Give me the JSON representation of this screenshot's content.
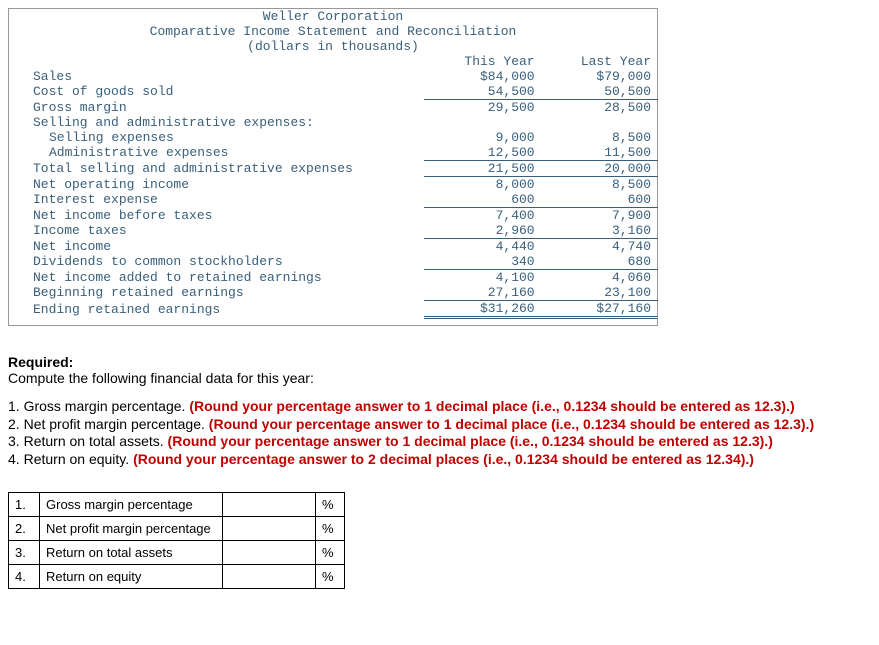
{
  "header": {
    "company": "Weller Corporation",
    "title": "Comparative Income Statement and Reconciliation",
    "sub": "(dollars in thousands)"
  },
  "cols": {
    "c1": "This Year",
    "c2": "Last Year"
  },
  "rows": {
    "sales": {
      "l": "Sales",
      "a": "$84,000",
      "b": "$79,000"
    },
    "cogs": {
      "l": "Cost of goods sold",
      "a": "54,500",
      "b": "50,500"
    },
    "gross": {
      "l": "Gross margin",
      "a": "29,500",
      "b": "28,500"
    },
    "sga_hdr": {
      "l": "Selling and administrative expenses:"
    },
    "sellexp": {
      "l": "Selling expenses",
      "a": "9,000",
      "b": "8,500"
    },
    "admexp": {
      "l": "Administrative expenses",
      "a": "12,500",
      "b": "11,500"
    },
    "totsga": {
      "l": "Total selling and administrative expenses",
      "a": "21,500",
      "b": "20,000"
    },
    "netop": {
      "l": "Net operating income",
      "a": "8,000",
      "b": "8,500"
    },
    "intexp": {
      "l": "Interest expense",
      "a": "600",
      "b": "600"
    },
    "nibt": {
      "l": "Net income before taxes",
      "a": "7,400",
      "b": "7,900"
    },
    "taxes": {
      "l": "Income taxes",
      "a": "2,960",
      "b": "3,160"
    },
    "netinc": {
      "l": "Net income",
      "a": "4,440",
      "b": "4,740"
    },
    "divs": {
      "l": "Dividends to common stockholders",
      "a": "340",
      "b": "680"
    },
    "ni_ret": {
      "l": "Net income added to retained earnings",
      "a": "4,100",
      "b": "4,060"
    },
    "begre": {
      "l": "Beginning retained earnings",
      "a": "27,160",
      "b": "23,100"
    },
    "endre": {
      "l": "Ending retained earnings",
      "a": "$31,260",
      "b": "$27,160"
    }
  },
  "required": {
    "heading": "Required:",
    "intro": "Compute the following financial data for this year:"
  },
  "instructions": {
    "i1": {
      "n": "1. ",
      "t": "Gross margin percentage. ",
      "r": "(Round your percentage answer to 1 decimal place (i.e., 0.1234 should be entered as 12.3).)"
    },
    "i2": {
      "n": "2. ",
      "t": "Net profit margin percentage. ",
      "r": "(Round your percentage answer to 1 decimal place (i.e., 0.1234 should be entered as 12.3).)"
    },
    "i3": {
      "n": "3. ",
      "t": "Return on total assets. ",
      "r": "(Round your percentage answer to 1 decimal place (i.e., 0.1234 should be entered as 12.3).)"
    },
    "i4": {
      "n": "4. ",
      "t": "Return on equity. ",
      "r": "(Round your percentage answer to 2 decimal places (i.e., 0.1234 should be entered as 12.34).)"
    }
  },
  "answers": {
    "r1": {
      "n": "1.",
      "l": "Gross margin percentage",
      "u": "%"
    },
    "r2": {
      "n": "2.",
      "l": "Net profit margin percentage",
      "u": "%"
    },
    "r3": {
      "n": "3.",
      "l": "Return on total assets",
      "u": "%"
    },
    "r4": {
      "n": "4.",
      "l": "Return on equity",
      "u": "%"
    }
  }
}
